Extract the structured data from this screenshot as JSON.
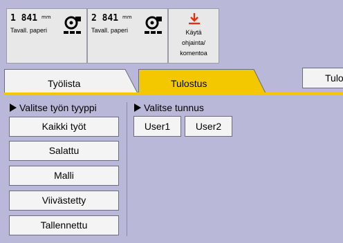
{
  "rolls": [
    {
      "length": "1 841",
      "unit": "mm",
      "paper_type": "Tavall. paperi",
      "icon": "paper-roll-icon"
    },
    {
      "length": "2 841",
      "unit": "mm",
      "paper_type": "Tavall. paperi",
      "icon": "paper-roll-icon"
    }
  ],
  "apply_button": {
    "lines": [
      "Käytä",
      "ohjainta/",
      "komentoa"
    ],
    "icon": "download-arrow-icon",
    "icon_color": "#e03010"
  },
  "tabs": [
    {
      "label": "Työlista",
      "active": false
    },
    {
      "label": "Tulostus",
      "active": true
    }
  ],
  "tulo_button": {
    "label": "Tulo"
  },
  "job_type": {
    "heading": "Valitse työn tyyppi",
    "items": [
      "Kaikki työt",
      "Salattu",
      "Malli",
      "Viivästetty",
      "Tallennettu"
    ]
  },
  "user_id": {
    "heading": "Valitse tunnus",
    "items": [
      "User1",
      "User2"
    ]
  },
  "colors": {
    "background": "#b9b8d9",
    "active_tab": "#f3c800"
  }
}
